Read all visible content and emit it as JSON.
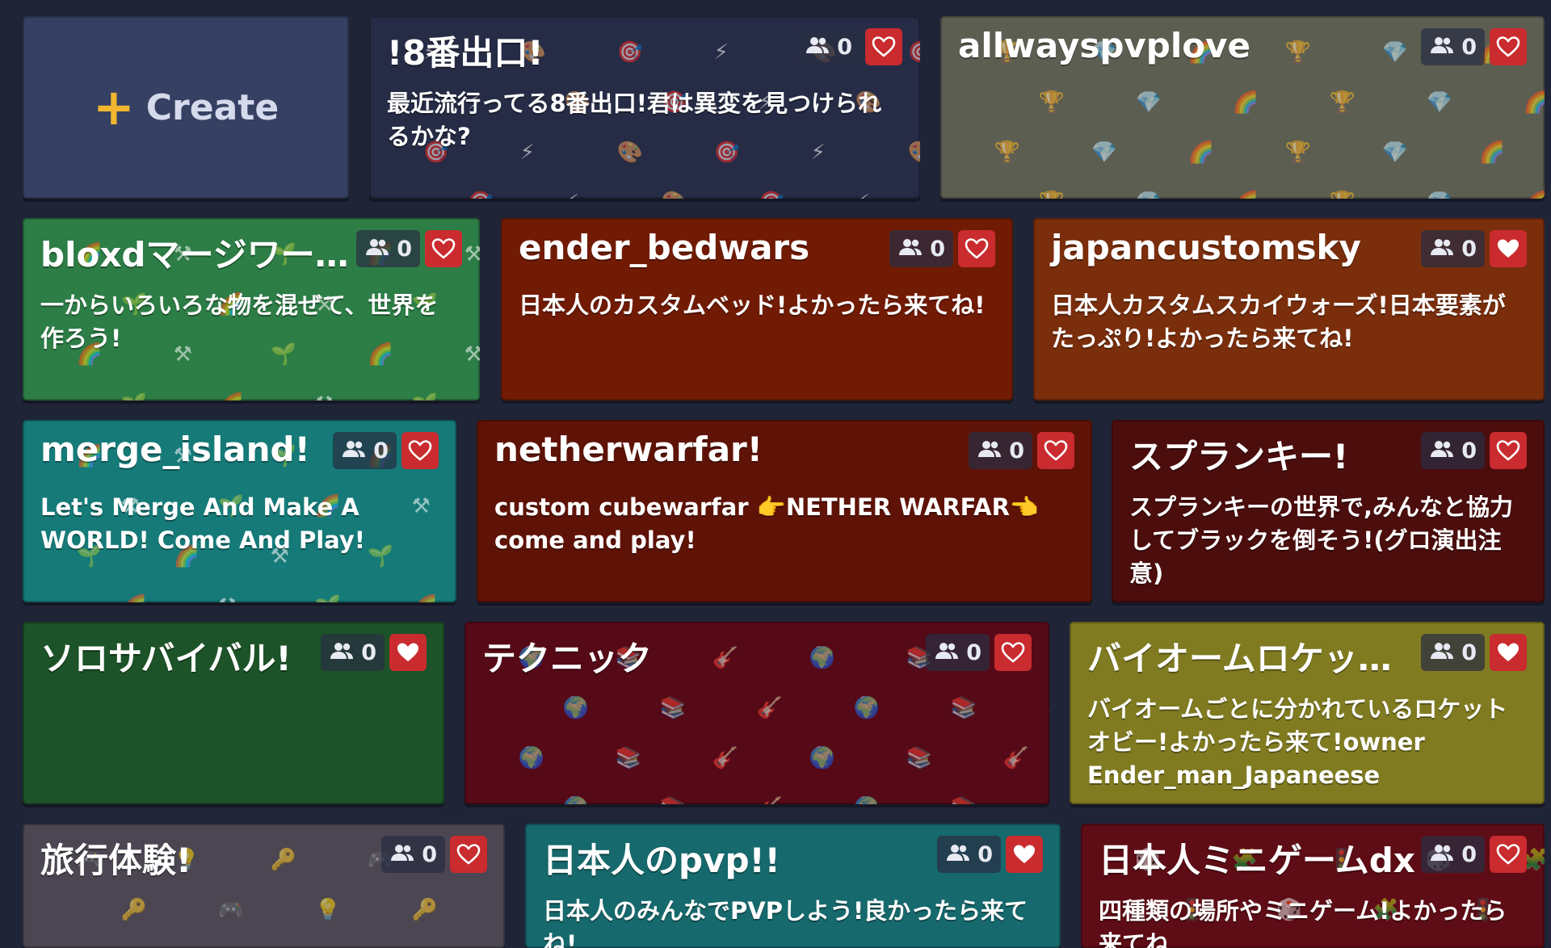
{
  "create": {
    "plus": "+",
    "label": "Create"
  },
  "cards": [
    {
      "title": "!8番出口!",
      "description": "最近流行ってる8番出口!君は異変を見つけられるかな?",
      "players": "0",
      "liked": false,
      "bg": "#262c45",
      "pattern": [
        "⚡",
        "🎨",
        "🎯"
      ]
    },
    {
      "title": "allwayspvplove",
      "description": "",
      "players": "0",
      "liked": false,
      "bg": "#5d5e52",
      "pattern": [
        "🏆",
        "💎",
        "🌈"
      ]
    },
    {
      "title": "bloxdマージワー…",
      "description": "一からいろいろな物を混ぜて、世界を作ろう!",
      "players": "0",
      "liked": false,
      "bg": "#2d7d46",
      "pattern": [
        "🌈",
        "⚒",
        "🌱"
      ]
    },
    {
      "title": "ender_bedwars",
      "description": "日本人のカスタムベッド!よかったら来てね!",
      "players": "0",
      "liked": false,
      "bg": "#721b04",
      "pattern": []
    },
    {
      "title": "japancustomsky",
      "description": "日本人カスタムスカイウォーズ!日本要素がたっぷり!よかったら来てね!",
      "players": "0",
      "liked": true,
      "bg": "#7b2e0c",
      "pattern": []
    },
    {
      "title": "merge_island!",
      "description": "Let's Merge And Make A WORLD! Come And Play!",
      "players": "0",
      "liked": false,
      "bg": "#157a78",
      "pattern": [
        "🌈",
        "⚒",
        "🌱"
      ]
    },
    {
      "title": "netherwarfar!",
      "description": "custom cubewarfar 👉NETHER WARFAR👈 come and play!",
      "players": "0",
      "liked": false,
      "bg": "#5f1307",
      "pattern": []
    },
    {
      "title": "スプランキー!",
      "description": "スプランキーの世界で,みんなと協力してブラックを倒そう!(グロ演出注意)",
      "players": "0",
      "liked": false,
      "bg": "#4c0d0d",
      "pattern": []
    },
    {
      "title": "ソロサバイバル!",
      "description": "",
      "players": "0",
      "liked": true,
      "bg": "#1d5328",
      "pattern": []
    },
    {
      "title": "テクニック",
      "description": "",
      "players": "0",
      "liked": false,
      "bg": "#560917",
      "pattern": [
        "🌍",
        "📚",
        "🎸"
      ]
    },
    {
      "title": "バイオームロケッ…",
      "description": "バイオームごとに分かれているロケットオビー!よかったら来て!owner Ender_man_Japaneese",
      "players": "0",
      "liked": true,
      "bg": "#807b21",
      "pattern": []
    },
    {
      "title": "旅行体験!",
      "description": "",
      "players": "0",
      "liked": false,
      "bg": "#4b4651",
      "pattern": [
        "🎮",
        "💡",
        "🔑"
      ]
    },
    {
      "title": "日本人のpvp!!",
      "description": "日本人のみんなでPVPしよう!良かったら来てね!",
      "players": "0",
      "liked": true,
      "bg": "#16696c",
      "pattern": []
    },
    {
      "title": "日本人ミニゲームdx",
      "description": "四種類の場所やミニゲーム!よかったら来てね",
      "players": "0",
      "liked": false,
      "bg": "#5e0c15",
      "pattern": [
        "🎲",
        "🧩",
        "🚦"
      ]
    }
  ]
}
